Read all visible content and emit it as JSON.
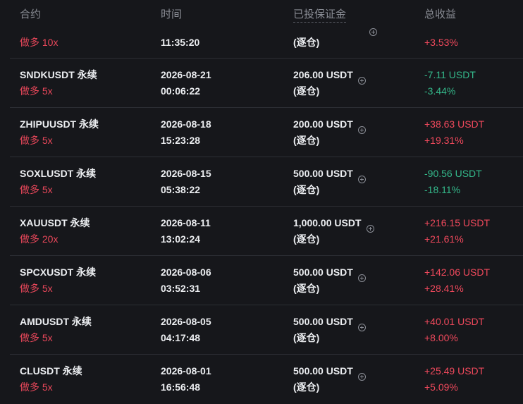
{
  "header": {
    "col_contract": "合约",
    "col_time": "时间",
    "col_margin": "已投保证金",
    "col_pnl": "总收益"
  },
  "partial_row": {
    "leverage": "做多 10x",
    "time": "11:35:20",
    "mode": "(逐仓)",
    "pnl_pct": "+3.53%",
    "direction": "positive"
  },
  "rows": [
    {
      "symbol": "SNDKUSDT 永续",
      "leverage": "做多 5x",
      "date": "2026-08-21",
      "time": "00:06:22",
      "margin": "206.00 USDT",
      "mode": "(逐仓)",
      "pnl": "-7.11 USDT",
      "pnl_pct": "-3.44%",
      "direction": "negative"
    },
    {
      "symbol": "ZHIPUUSDT 永续",
      "leverage": "做多 5x",
      "date": "2026-08-18",
      "time": "15:23:28",
      "margin": "200.00 USDT",
      "mode": "(逐仓)",
      "pnl": "+38.63 USDT",
      "pnl_pct": "+19.31%",
      "direction": "positive"
    },
    {
      "symbol": "SOXLUSDT 永续",
      "leverage": "做多 5x",
      "date": "2026-08-15",
      "time": "05:38:22",
      "margin": "500.00 USDT",
      "mode": "(逐仓)",
      "pnl": "-90.56 USDT",
      "pnl_pct": "-18.11%",
      "direction": "negative"
    },
    {
      "symbol": "XAUUSDT 永续",
      "leverage": "做多 20x",
      "date": "2026-08-11",
      "time": "13:02:24",
      "margin": "1,000.00 USDT",
      "mode": "(逐仓)",
      "pnl": "+216.15 USDT",
      "pnl_pct": "+21.61%",
      "direction": "positive"
    },
    {
      "symbol": "SPCXUSDT 永续",
      "leverage": "做多 5x",
      "date": "2026-08-06",
      "time": "03:52:31",
      "margin": "500.00 USDT",
      "mode": "(逐仓)",
      "pnl": "+142.06 USDT",
      "pnl_pct": "+28.41%",
      "direction": "positive"
    },
    {
      "symbol": "AMDUSDT 永续",
      "leverage": "做多 5x",
      "date": "2026-08-05",
      "time": "04:17:48",
      "margin": "500.00 USDT",
      "mode": "(逐仓)",
      "pnl": "+40.01 USDT",
      "pnl_pct": "+8.00%",
      "direction": "positive"
    },
    {
      "symbol": "CLUSDT 永续",
      "leverage": "做多 5x",
      "date": "2026-08-01",
      "time": "16:56:48",
      "margin": "500.00 USDT",
      "mode": "(逐仓)",
      "pnl": "+25.49 USDT",
      "pnl_pct": "+5.09%",
      "direction": "positive"
    }
  ],
  "icons": {
    "add_margin": "plus-circle-icon"
  },
  "colors": {
    "positive": "#f0495c",
    "negative": "#34b98b",
    "leverage": "#e8475a"
  }
}
